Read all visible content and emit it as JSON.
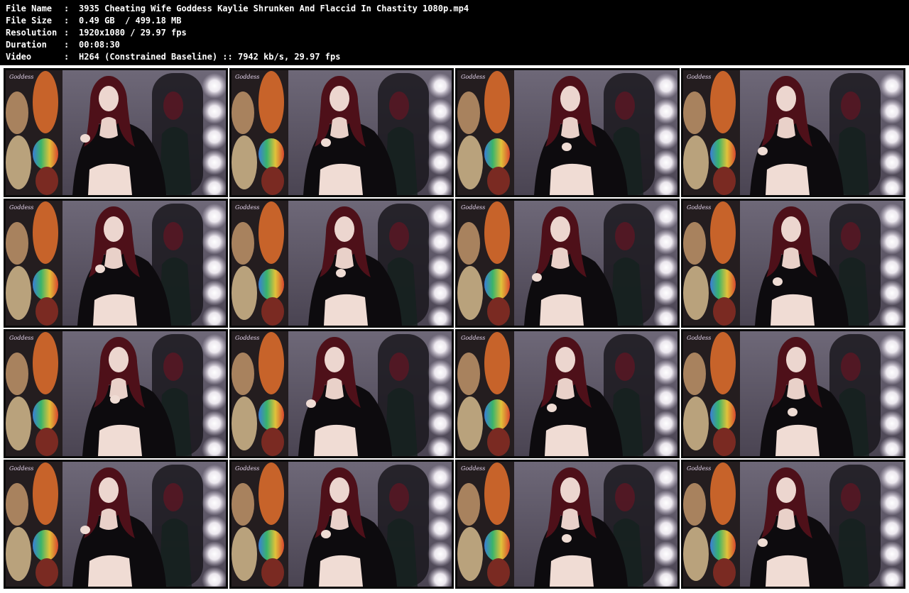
{
  "file_info": [
    {
      "key": "File Name",
      "value": "3935 Cheating Wife Goddess Kaylie Shrunken And Flaccid In Chastity 1080p.mp4"
    },
    {
      "key": "File Size",
      "value": "0.49 GB  / 499.18 MB"
    },
    {
      "key": "Resolution",
      "value": "1920x1080 / 29.97 fps"
    },
    {
      "key": "Duration",
      "value": "00:08:30"
    },
    {
      "key": "Video",
      "value": "H264 (Constrained Baseline) :: 7942 kb/s, 29.97 fps"
    }
  ],
  "separator": ":",
  "thumbnail_grid": {
    "rows": 4,
    "columns": 4,
    "count": 16
  },
  "colors": {
    "page_background": "#000000",
    "header_text": "#ffffff",
    "grid_background": "#ffffff",
    "thumb_border": "#0a0a0a"
  }
}
